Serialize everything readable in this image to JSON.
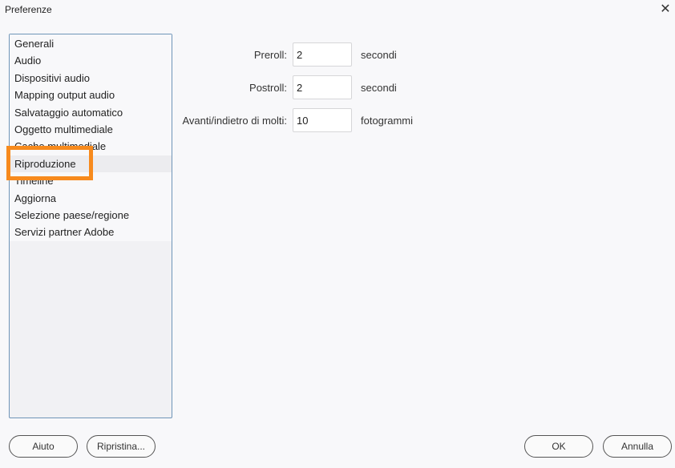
{
  "window": {
    "title": "Preferenze",
    "close_icon": "close-icon"
  },
  "sidebar": {
    "items": [
      {
        "label": "Generali"
      },
      {
        "label": "Audio"
      },
      {
        "label": "Dispositivi audio"
      },
      {
        "label": "Mapping output audio"
      },
      {
        "label": "Salvataggio automatico"
      },
      {
        "label": "Oggetto multimediale"
      },
      {
        "label": "Cache multimediale"
      },
      {
        "label": "Riproduzione",
        "selected": true
      },
      {
        "label": "Timeline"
      },
      {
        "label": "Aggiorna"
      },
      {
        "label": "Selezione paese/regione"
      },
      {
        "label": "Servizi partner Adobe"
      }
    ],
    "highlight_color": "#f78a1d"
  },
  "form": {
    "preroll": {
      "label": "Preroll:",
      "value": "2",
      "unit": "secondi"
    },
    "postroll": {
      "label": "Postroll:",
      "value": "2",
      "unit": "secondi"
    },
    "multi": {
      "label": "Avanti/indietro di molti:",
      "value": "10",
      "unit": "fotogrammi"
    }
  },
  "buttons": {
    "help": "Aiuto",
    "reset": "Ripristina...",
    "ok": "OK",
    "cancel": "Annulla"
  }
}
